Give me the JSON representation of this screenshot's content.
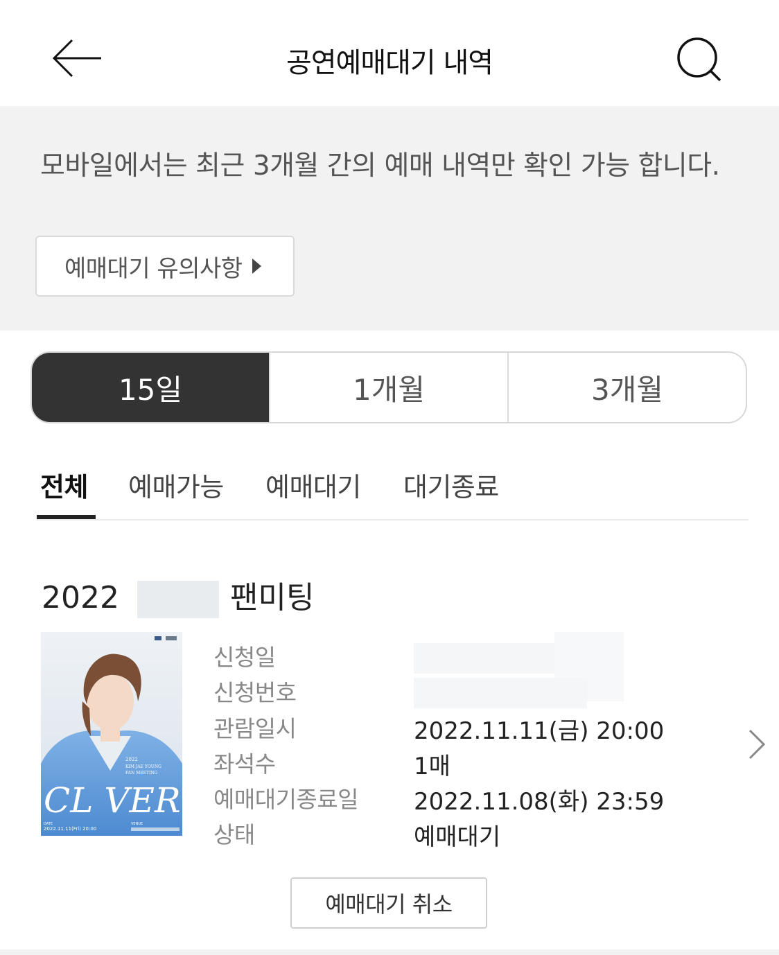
{
  "header": {
    "title": "공연예매대기 내역",
    "back_icon": "arrow-left-icon",
    "search_icon": "search-icon"
  },
  "notice": {
    "text": "모바일에서는 최근 3개월 간의 예매 내역만 확인 가능 합니다.",
    "button_label": "예매대기 유의사항"
  },
  "period_filter": {
    "options": [
      "15일",
      "1개월",
      "3개월"
    ],
    "selected": "15일"
  },
  "status_tabs": {
    "items": [
      "전체",
      "예매가능",
      "예매대기",
      "대기종료"
    ],
    "selected": "전체"
  },
  "booking": {
    "title_prefix": "2022",
    "title_suffix": "팬미팅",
    "poster": {
      "headline": "CL VER",
      "subtitle_lines": [
        "2022",
        "KIM JAE YOUNG",
        "FAN MEETING"
      ],
      "date_label": "DATE",
      "date_value": "2022.11.11(Fri) 20:00",
      "venue_label": "VENUE"
    },
    "labels": {
      "apply_date": "신청일",
      "apply_number": "신청번호",
      "show_datetime": "관람일시",
      "seats": "좌석수",
      "wait_end_date": "예매대기종료일",
      "status": "상태"
    },
    "values": {
      "show_datetime": "2022.11.11(금) 20:00",
      "seats": "1매",
      "wait_end_date": "2022.11.08(화) 23:59",
      "status": "예매대기"
    },
    "cancel_label": "예매대기 취소"
  },
  "colors": {
    "active_segment_bg": "#333333",
    "notice_bg": "#f2f2f2",
    "label_gray": "#888888"
  }
}
